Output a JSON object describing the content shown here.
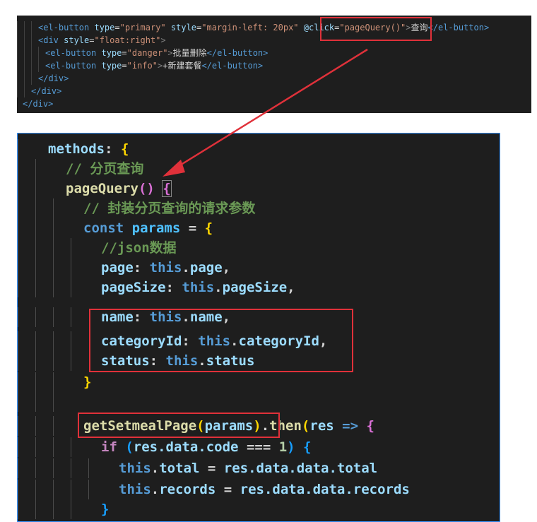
{
  "top_code": {
    "l1": {
      "indent": "    ",
      "t1": "<el-button ",
      "a1": "type",
      "e1": "=",
      "s1": "\"primary\"",
      "sp1": " ",
      "a2": "style",
      "e2": "=",
      "s2": "\"margin-left: 20px\"",
      "sp2": " ",
      "a3": "@click",
      "e3": "=",
      "s3": "\"pageQuery()\"",
      "gt": ">",
      "text": "查询",
      "close": "</el-button>"
    },
    "l2": {
      "t1": "<div ",
      "a1": "style",
      "e1": "=",
      "s1": "\"float:right\"",
      "gt": ">"
    },
    "l3": {
      "t1": "<el-button ",
      "a1": "type",
      "e1": "=",
      "s1": "\"danger\"",
      "gt": ">",
      "text": "批量删除",
      "close": "</el-button>"
    },
    "l4": {
      "t1": "<el-button ",
      "a1": "type",
      "e1": "=",
      "s1": "\"info\"",
      "gt": ">",
      "text": "+新建套餐",
      "close": "</el-button>"
    },
    "l5": "</div>",
    "l6": "</div>",
    "l7": "</div>"
  },
  "bottom_code": {
    "methods": "methods",
    "colon": ": ",
    "brace_open": "{",
    "comment1": "// 分页查询",
    "fn_name": "pageQuery",
    "parens": "()",
    "sp": " ",
    "fn_brace": "{",
    "comment2": "// 封装分页查询的请求参数",
    "const": "const",
    "params": "params",
    "eq": " = ",
    "obj_brace": "{",
    "comment3": "//json数据",
    "props": [
      {
        "key": "page",
        "sep": ": ",
        "this": "this",
        "dot": ".",
        "val": "page",
        "end": ","
      },
      {
        "key": "pageSize",
        "sep": ": ",
        "this": "this",
        "dot": ".",
        "val": "pageSize",
        "end": ","
      },
      {
        "key": "name",
        "sep": ": ",
        "this": "this",
        "dot": ".",
        "val": "name",
        "end": ","
      },
      {
        "key": "categoryId",
        "sep": ": ",
        "this": "this",
        "dot": ".",
        "val": "categoryId",
        "end": ","
      },
      {
        "key": "status",
        "sep": ": ",
        "this": "this",
        "dot": ".",
        "val": "status",
        "end": ""
      }
    ],
    "obj_close": "}",
    "call_fn": "getSetmealPage",
    "call_open": "(",
    "call_arg": "params",
    "call_close": ")",
    "then_dot": ".",
    "then_fn": "then",
    "then_open": "(",
    "res": "res",
    "arrow": " => ",
    "then_brace": "{",
    "if_kw": "if",
    "if_open": " (",
    "if_res": "res",
    "if_path": ".data.code",
    "if_op": " === ",
    "if_num": "1",
    "if_close": ") ",
    "if_brace": "{",
    "total_this": "this",
    "total_dot": ".",
    "total_prop": "total",
    "total_eq": " = ",
    "total_val": "res.data.data.total",
    "records_this": "this",
    "records_dot": ".",
    "records_prop": "records",
    "records_eq": " = ",
    "records_val": "res.data.data.records",
    "if_end": "}"
  },
  "colors": {
    "highlight": "#e0313a",
    "editor_bg": "#1e1e1e",
    "focus_border": "#3794ff"
  }
}
